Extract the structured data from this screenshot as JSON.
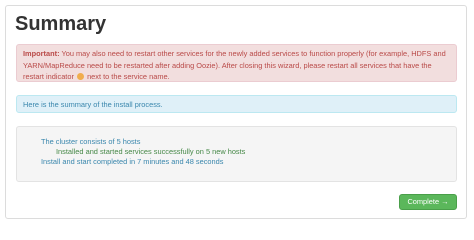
{
  "page": {
    "title": "Summary"
  },
  "alert_important": {
    "label": "Important:",
    "text_before_icon": "You may also need to restart other services for the newly added services to function properly (for example, HDFS and YARN/MapReduce need to be restarted after adding Oozie). After closing this wizard, please restart all services that have the restart indicator",
    "icon": "restart-indicator-icon",
    "text_after_icon": "next to the service name."
  },
  "info_alert": {
    "text": "Here is the summary of the install process."
  },
  "summary": {
    "line1": "The cluster consists of 5 hosts",
    "line2": "Installed and started services successfully on 5 new hosts",
    "line3": "Install and start completed in 7 minutes and 48 seconds"
  },
  "actions": {
    "complete_label": "Complete →"
  },
  "colors": {
    "danger_bg": "#f2dede",
    "danger_text": "#b94a48",
    "info_bg": "#dff0f8",
    "info_text": "#3a87ad",
    "success_text": "#468847",
    "button_bg": "#5bb75b"
  }
}
